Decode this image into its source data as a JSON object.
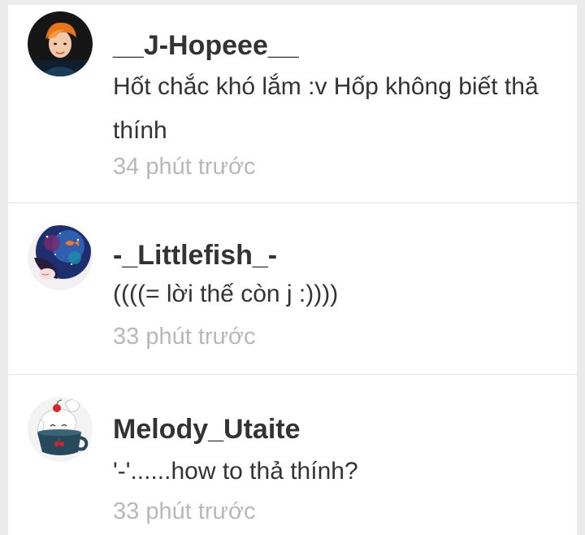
{
  "comments": [
    {
      "username": "__J-Hopeee__",
      "text": "Hốt chắc khó lắm :v Hốp không biết thả thính",
      "time": "34 phút trước",
      "avatar_icon": "avatar-orange-hair-person-icon"
    },
    {
      "username": "-_Littlefish_-",
      "text": "((((= lời thế còn j :))))",
      "time": "33 phút trước",
      "avatar_icon": "avatar-galaxy-fish-girl-icon"
    },
    {
      "username": "Melody_Utaite",
      "text": "'-'......how to thả thính?",
      "time": "33 phút trước",
      "avatar_icon": "avatar-chibi-teacup-icon"
    }
  ],
  "colors": {
    "background": "#ebebeb",
    "card": "#ffffff",
    "username": "#333333",
    "body_text": "#333333",
    "timestamp": "#b8b8b8",
    "divider": "#e2e2e2"
  }
}
